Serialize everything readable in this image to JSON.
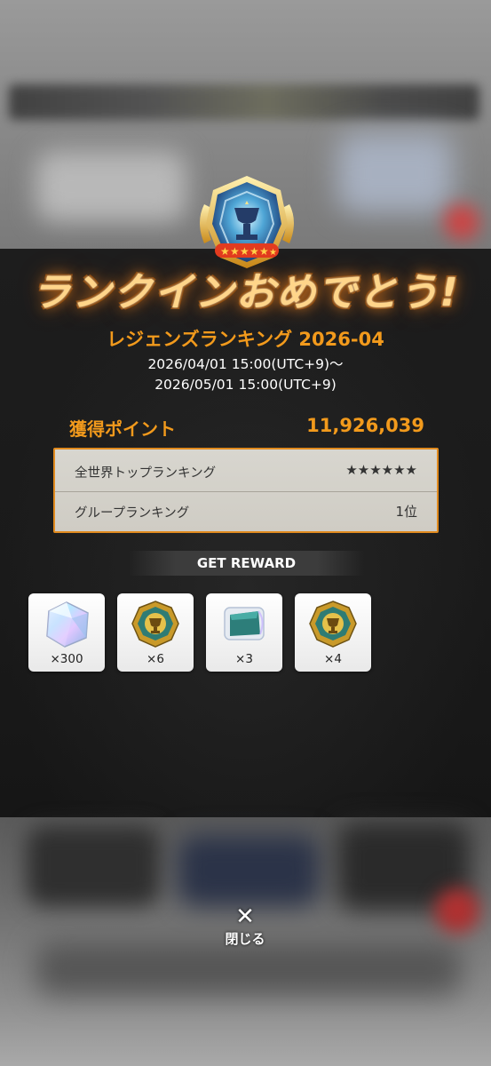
{
  "congrats_title": "ランクインおめでとう!",
  "event": {
    "name": "レジェンズランキング 2026-04",
    "period_start": "2026/04/01 15:00(UTC+9)～",
    "period_end": "2026/05/01 15:00(UTC+9)"
  },
  "points": {
    "label": "獲得ポイント",
    "value": "11,926,039"
  },
  "rankings": [
    {
      "label": "全世界トップランキング",
      "value": "★★★★★★"
    },
    {
      "label": "グループランキング",
      "value": "1位"
    }
  ],
  "reward_header": "GET REWARD",
  "rewards": [
    {
      "icon": "crystal-icon",
      "qty": "×300"
    },
    {
      "icon": "gold-medal-icon",
      "qty": "×6"
    },
    {
      "icon": "ticket-icon",
      "qty": "×3"
    },
    {
      "icon": "gold-medal-icon",
      "qty": "×4"
    }
  ],
  "close": {
    "icon": "close-icon",
    "label": "閉じる"
  },
  "colors": {
    "accent": "#f29a1c",
    "panel": "#1b1b1b",
    "rank_border": "#e08a1e"
  }
}
